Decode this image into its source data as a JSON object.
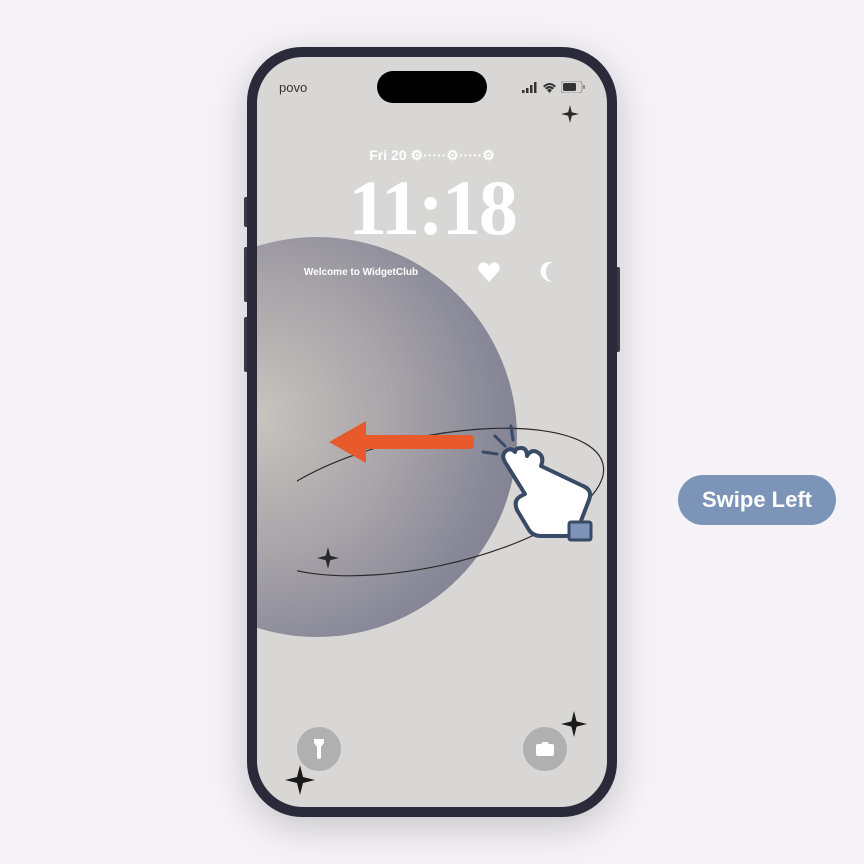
{
  "status": {
    "carrier": "povo"
  },
  "lockscreen": {
    "date": "Fri 20",
    "date_decor": " ⚙·····⚙·····⚙",
    "time": "11:18",
    "welcome": "Welcome to WidgetClub"
  },
  "instruction": {
    "label": "Swipe Left"
  },
  "colors": {
    "arrow": "#e85a2b",
    "pill": "#7b94b8"
  }
}
